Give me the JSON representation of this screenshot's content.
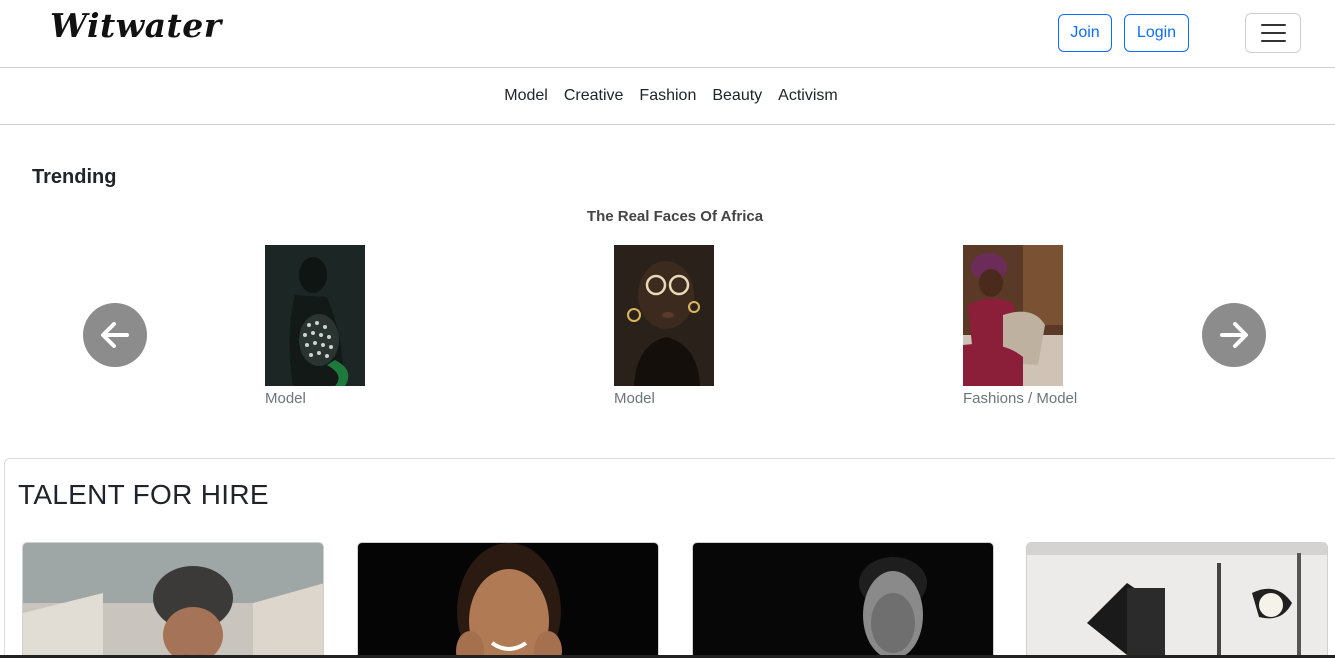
{
  "header": {
    "brand": "Witwater",
    "join_label": "Join",
    "login_label": "Login",
    "menu_icon": "hamburger-menu-icon"
  },
  "categories": [
    "Model",
    "Creative",
    "Fashion",
    "Beauty",
    "Activism"
  ],
  "trending": {
    "title": "Trending",
    "subtitle": "The Real Faces Of Africa",
    "prev_icon": "arrow-left-icon",
    "next_icon": "arrow-right-icon",
    "items": [
      {
        "caption": "Model"
      },
      {
        "caption": "Model"
      },
      {
        "caption": "Fashions / Model"
      }
    ]
  },
  "talent": {
    "title": "TALENT FOR HIRE"
  },
  "colors": {
    "primary": "#0d6efd",
    "arrow_bg": "#8c8c8c",
    "caption": "#6c757d"
  }
}
